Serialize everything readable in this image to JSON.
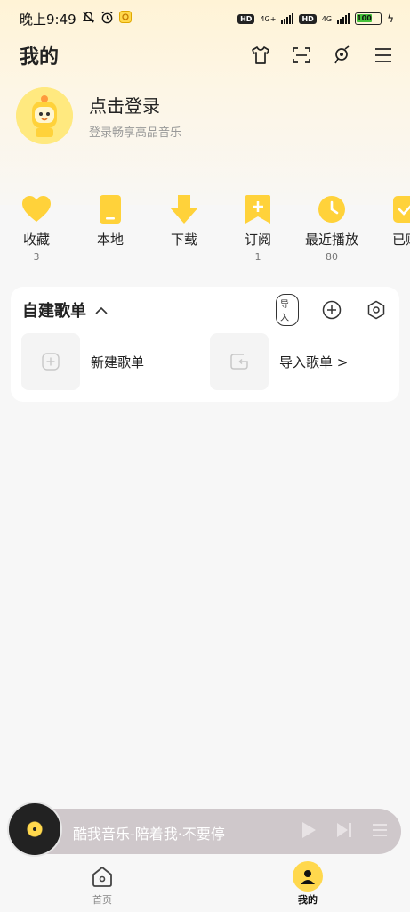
{
  "status_bar": {
    "time": "晚上9:49",
    "net1": "4G+",
    "net2": "4G",
    "battery": "100"
  },
  "header": {
    "title": "我的",
    "icons": [
      "shirt-icon",
      "scan-icon",
      "mic-icon",
      "menu-icon"
    ]
  },
  "profile": {
    "login_title": "点击登录",
    "login_subtitle": "登录畅享高品音乐"
  },
  "quick_links": [
    {
      "label": "收藏",
      "count": "3",
      "icon": "heart-icon"
    },
    {
      "label": "本地",
      "count": "",
      "icon": "phone-icon"
    },
    {
      "label": "下载",
      "count": "",
      "icon": "download-icon"
    },
    {
      "label": "订阅",
      "count": "1",
      "icon": "bookmark-icon"
    },
    {
      "label": "最近播放",
      "count": "80",
      "icon": "clock-icon"
    },
    {
      "label": "已购",
      "count": "",
      "icon": "check-icon"
    }
  ],
  "playlists": {
    "title": "自建歌单",
    "import_badge": "导入",
    "new_playlist": "新建歌单",
    "import_playlist": "导入歌单 >"
  },
  "player": {
    "now_playing": "酷我音乐-陪着我·不要停"
  },
  "bottom_nav": {
    "home": "首页",
    "me": "我的"
  },
  "colors": {
    "accent": "#ffd84d",
    "player_bg": "#cfc8cb"
  }
}
